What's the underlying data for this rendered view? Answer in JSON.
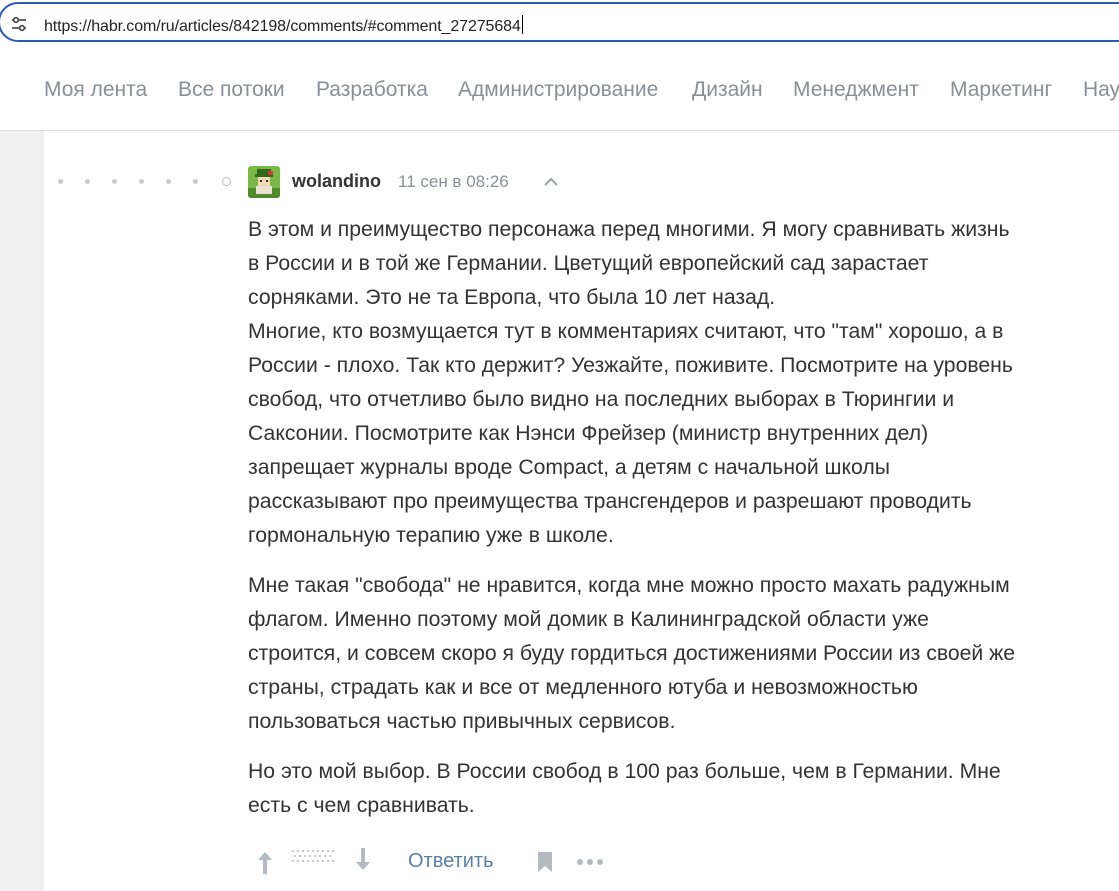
{
  "browser": {
    "url": "https://habr.com/ru/articles/842198/comments/#comment_27275684",
    "icons": {
      "site_settings": "tune-icon"
    }
  },
  "nav": {
    "items": [
      {
        "label": "Моя лента"
      },
      {
        "label": "Все потоки"
      },
      {
        "label": "Разработка"
      },
      {
        "label": "Администрирование"
      },
      {
        "label": "Дизайн"
      },
      {
        "label": "Менеджмент"
      },
      {
        "label": "Маркетинг"
      },
      {
        "label": "Нау"
      }
    ]
  },
  "comment": {
    "author": "wolandino",
    "timestamp": "11 сен в 08:26",
    "paragraphs": [
      [
        "В этом и преимущество персонажа перед многими. Я могу сравнивать жизнь",
        "в России и в той же Германии. Цветущий европейский сад зарастает",
        "сорняками. Это не та Европа, что была 10 лет назад.",
        "Многие, кто возмущается тут в комментариях считают, что \"там\" хорошо, а в",
        "России - плохо. Так кто держит? Уезжайте, поживите. Посмотрите на уровень",
        "свобод, что отчетливо было видно на последних выборах в Тюрингии и",
        "Саксонии. Посмотрите как Нэнси Фрейзер (министр внутренних дел)",
        "запрещает журналы вроде Compact, а детям с начальной школы",
        "рассказывают про преимущества трансгендеров и разрешают проводить",
        "гормональную терапию уже в школе."
      ],
      [
        "Мне такая \"свобода\" не нравится, когда мне можно просто махать радужным",
        "флагом. Именно поэтому мой домик в Калининградской области уже",
        "строится, и совсем скоро я буду гордиться достижениями России из своей же",
        "страны, страдать как и все от медленного ютуба и невозможностью",
        "пользоваться частью привычных сервисов."
      ],
      [
        "Но это мой выбор. В России свобод в 100 раз больше, чем в Германии. Мне",
        "есть с чем сравнивать."
      ]
    ],
    "reply_label": "Ответить",
    "icons": {
      "collapse": "chevron-up-icon",
      "upvote": "arrow-up-icon",
      "downvote": "arrow-down-icon",
      "bookmark": "bookmark-icon",
      "more": "more-icon",
      "avatar": "avatar"
    }
  },
  "colors": {
    "url_border": "#2a5bb6",
    "nav_text": "#8a8f95",
    "reply_link": "#5a7fa6",
    "text": "#333333"
  }
}
